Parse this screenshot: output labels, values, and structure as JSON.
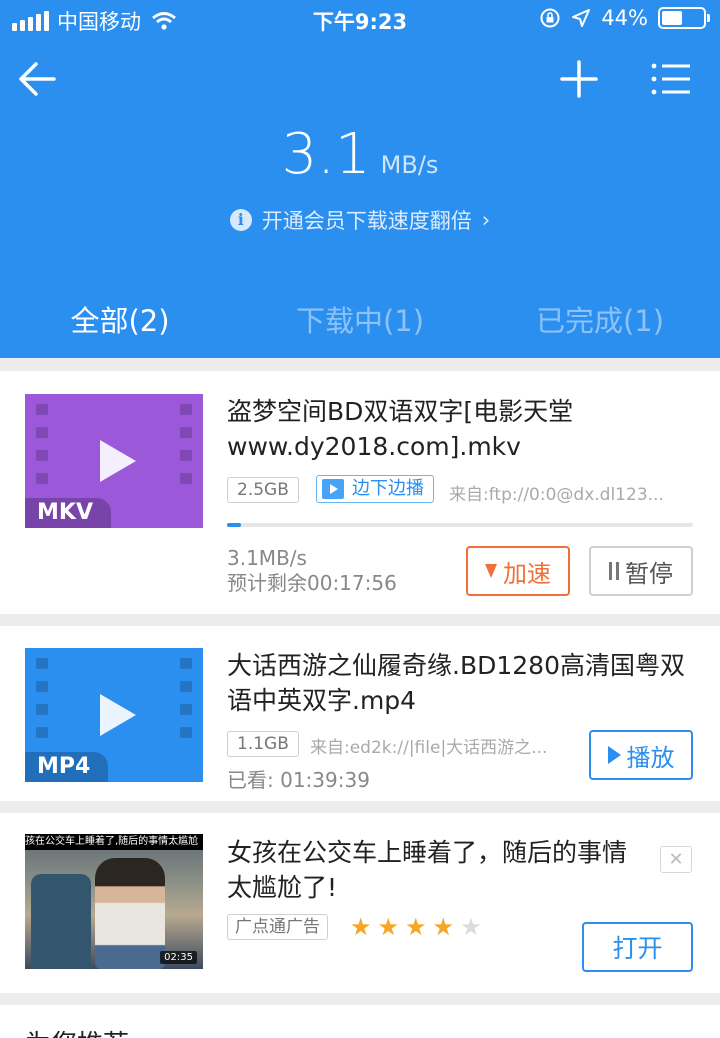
{
  "status_bar": {
    "carrier": "中国移动",
    "time": "下午9:23",
    "battery": "44%"
  },
  "header": {
    "speed_value": "3.1",
    "speed_unit": "MB/s",
    "vip_tip": "开通会员下载速度翻倍",
    "info_icon": "i",
    "chevron": "›"
  },
  "tabs": [
    {
      "label": "全部(2)",
      "active": true
    },
    {
      "label": "下载中(1)",
      "active": false
    },
    {
      "label": "已完成(1)",
      "active": false
    }
  ],
  "downloads": [
    {
      "format": "MKV",
      "thumb_color": "#9b58d9",
      "title": "盗梦空间BD双语双字[电影天堂www.dy2018.com].mkv",
      "size": "2.5GB",
      "stream_label": "边下边播",
      "source": "来自:ftp://0:0@dx.dl123...",
      "progress": 0.03,
      "speed": "3.1MB/s",
      "remaining": "预计剩余00:17:56",
      "accel_label": "加速",
      "pause_label": "暂停"
    },
    {
      "format": "MP4",
      "thumb_color": "#2b8ff0",
      "title": "大话西游之仙履奇缘.BD1280高清国粤双语中英双字.mp4",
      "size": "1.1GB",
      "source": "来自:ed2k://|file|大话西游之...",
      "watched": "已看:  01:39:39",
      "play_label": "播放"
    }
  ],
  "ad": {
    "thumb_caption": "孩在公交车上睡着了,随后的事情太尴尬",
    "duration": "02:35",
    "title": "女孩在公交车上睡着了，随后的事情太尴尬了!",
    "tag": "广点通广告",
    "rating": 4,
    "rating_max": 5,
    "open_label": "打开",
    "close": "✕"
  },
  "bottom_hint": "为您推荐"
}
